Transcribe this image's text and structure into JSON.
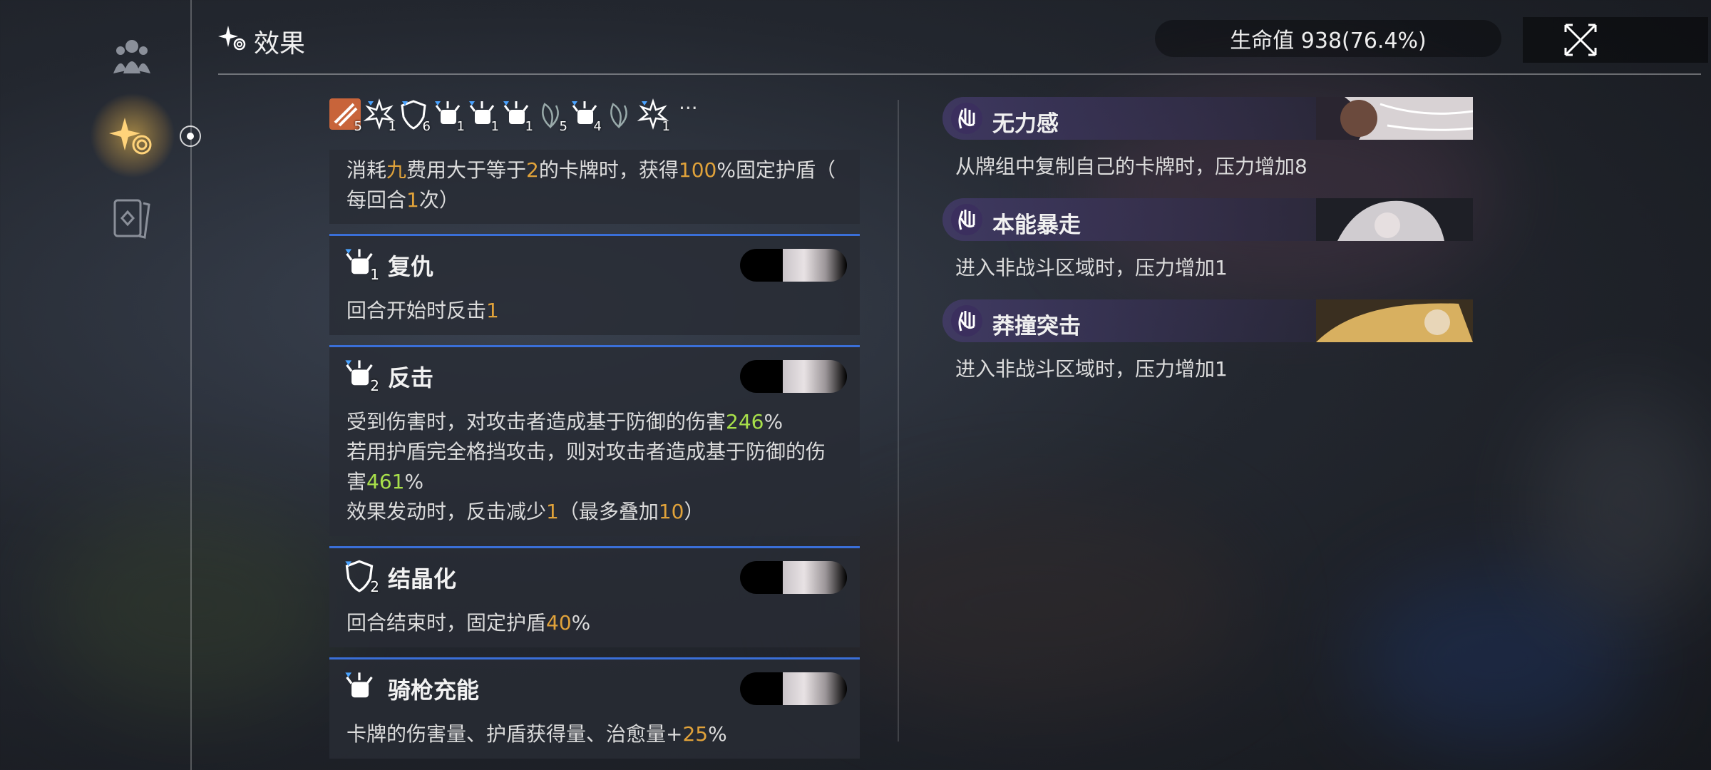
{
  "header": {
    "title": "效果",
    "hp_text": "生命值 938(76.4%)"
  },
  "colors": {
    "highlight_orange": "#e0a23a",
    "highlight_green": "#a8e04a",
    "accent_blue": "#3a6fd8",
    "active_glow": "#ffc850"
  },
  "rail": {
    "items": [
      {
        "icon": "team-icon",
        "active": false
      },
      {
        "icon": "effects-sparkle-icon",
        "active": true
      },
      {
        "icon": "card-deck-icon",
        "active": false
      }
    ]
  },
  "buff_strip": [
    {
      "icon": "orange-slash-icon",
      "count": "5"
    },
    {
      "icon": "burst-icon",
      "count": "1"
    },
    {
      "icon": "shield-icon",
      "count": "6"
    },
    {
      "icon": "fist-icon",
      "count": "1"
    },
    {
      "icon": "fist-icon",
      "count": "1"
    },
    {
      "icon": "fist-icon",
      "count": "1"
    },
    {
      "icon": "leaf-icon",
      "count": "5"
    },
    {
      "icon": "fist-icon",
      "count": "4"
    },
    {
      "icon": "leaf-icon",
      "count": ""
    },
    {
      "icon": "burst-icon",
      "count": "1"
    }
  ],
  "buff_more": "···",
  "left_cards": {
    "partial": {
      "line1_a": "消耗",
      "line1_b": "九",
      "line1_c": "费用大于等于",
      "line1_d": "2",
      "line1_e": "的卡牌时，获得",
      "line1_f": "100",
      "line1_g": "%固定护盾（",
      "line2_a": "每回合",
      "line2_b": "1",
      "line2_c": "次）"
    },
    "revenge": {
      "title": "复仇",
      "count": "1",
      "desc_a": "回合开始时反击",
      "desc_b": "1"
    },
    "counter": {
      "title": "反击",
      "count": "2",
      "l1_a": "受到伤害时，对攻击者造成基于防御的伤害",
      "l1_b": "246",
      "l1_c": "%",
      "l2": "若用护盾完全格挡攻击，则对攻击者造成基于防御的伤",
      "l3_a": "害",
      "l3_b": "461",
      "l3_c": "%",
      "l4_a": "效果发动时，反击减少",
      "l4_b": "1",
      "l4_c": "（最多叠加",
      "l4_d": "10",
      "l4_e": "）"
    },
    "crystal": {
      "title": "结晶化",
      "count": "2",
      "desc_a": "回合结束时，固定护盾",
      "desc_b": "40",
      "desc_c": "%"
    },
    "lance": {
      "title": "骑枪充能",
      "count": "",
      "desc_a": "卡牌的伤害量、护盾获得量、治愈量+",
      "desc_b": "25",
      "desc_c": "%"
    }
  },
  "right_tags": [
    {
      "title": "无力感",
      "desc": "从牌组中复制自己的卡牌时，压力增加8"
    },
    {
      "title": "本能暴走",
      "desc": "进入非战斗区域时，压力增加1"
    },
    {
      "title": "莽撞突击",
      "desc": "进入非战斗区域时，压力增加1"
    }
  ]
}
